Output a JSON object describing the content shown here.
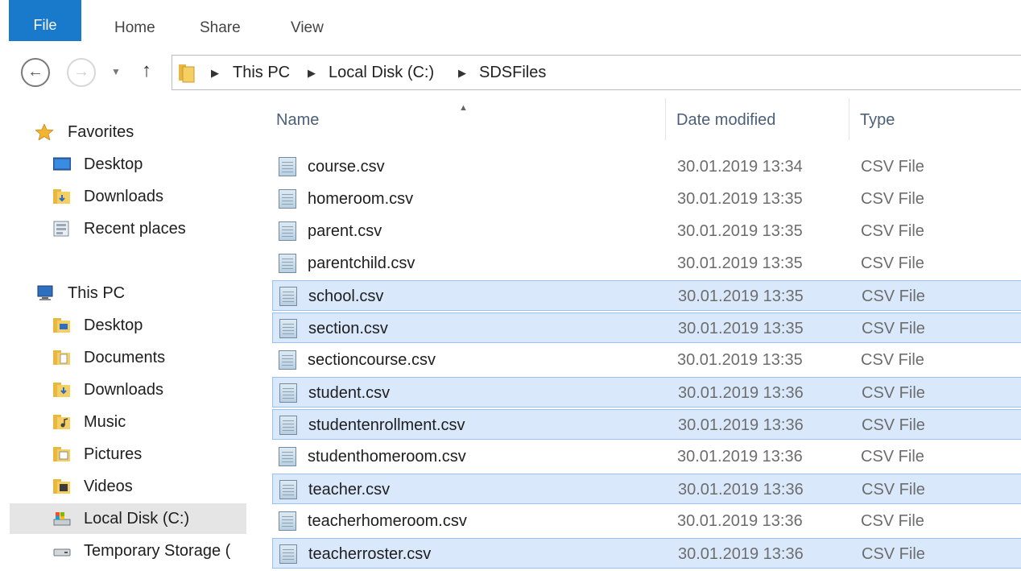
{
  "ribbon": {
    "tabs": [
      "File",
      "Home",
      "Share",
      "View"
    ]
  },
  "address": {
    "crumbs": [
      "This PC",
      "Local Disk (C:)",
      "SDSFiles"
    ]
  },
  "columns": {
    "name": "Name",
    "date": "Date modified",
    "type": "Type"
  },
  "nav": {
    "favorites": {
      "label": "Favorites",
      "items": [
        "Desktop",
        "Downloads",
        "Recent places"
      ]
    },
    "thispc": {
      "label": "This PC",
      "items": [
        "Desktop",
        "Documents",
        "Downloads",
        "Music",
        "Pictures",
        "Videos",
        "Local Disk (C:)",
        "Temporary Storage ("
      ]
    }
  },
  "files": [
    {
      "name": "course.csv",
      "date": "30.01.2019 13:34",
      "type": "CSV File",
      "selected": false
    },
    {
      "name": "homeroom.csv",
      "date": "30.01.2019 13:35",
      "type": "CSV File",
      "selected": false
    },
    {
      "name": "parent.csv",
      "date": "30.01.2019 13:35",
      "type": "CSV File",
      "selected": false
    },
    {
      "name": "parentchild.csv",
      "date": "30.01.2019 13:35",
      "type": "CSV File",
      "selected": false
    },
    {
      "name": "school.csv",
      "date": "30.01.2019 13:35",
      "type": "CSV File",
      "selected": true
    },
    {
      "name": "section.csv",
      "date": "30.01.2019 13:35",
      "type": "CSV File",
      "selected": true
    },
    {
      "name": "sectioncourse.csv",
      "date": "30.01.2019 13:35",
      "type": "CSV File",
      "selected": false
    },
    {
      "name": "student.csv",
      "date": "30.01.2019 13:36",
      "type": "CSV File",
      "selected": true
    },
    {
      "name": "studentenrollment.csv",
      "date": "30.01.2019 13:36",
      "type": "CSV File",
      "selected": true
    },
    {
      "name": "studenthomeroom.csv",
      "date": "30.01.2019 13:36",
      "type": "CSV File",
      "selected": false
    },
    {
      "name": "teacher.csv",
      "date": "30.01.2019 13:36",
      "type": "CSV File",
      "selected": true
    },
    {
      "name": "teacherhomeroom.csv",
      "date": "30.01.2019 13:36",
      "type": "CSV File",
      "selected": false
    },
    {
      "name": "teacherroster.csv",
      "date": "30.01.2019 13:36",
      "type": "CSV File",
      "selected": true
    }
  ],
  "colors": {
    "accent": "#1979ca",
    "selection": "#d9e8fb",
    "selection_border": "#99c1f1"
  }
}
